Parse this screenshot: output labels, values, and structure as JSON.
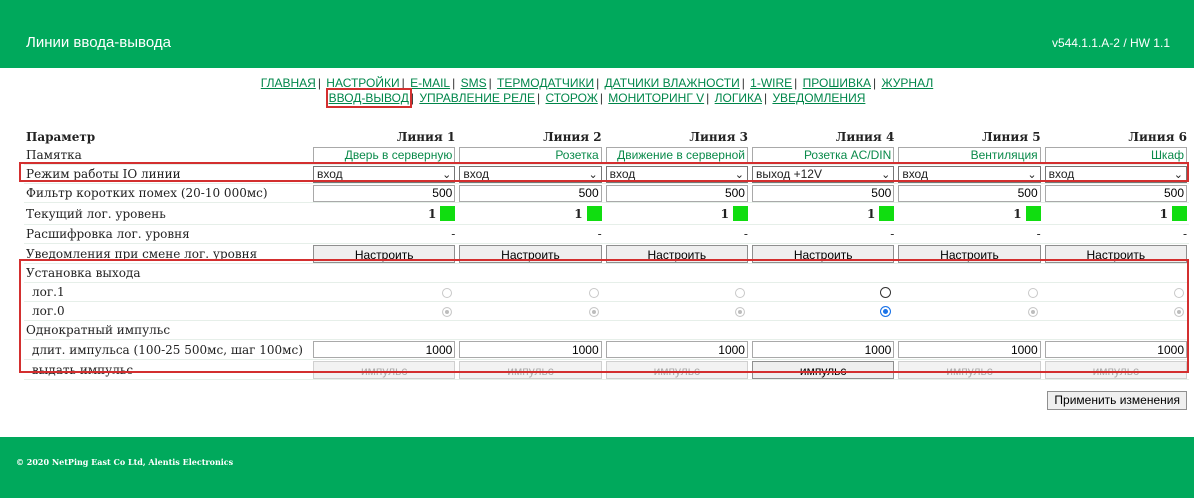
{
  "header": {
    "title": "Линии ввода-вывода",
    "version": "v544.1.1.A-2 / HW 1.1"
  },
  "nav": {
    "row1": [
      "ГЛАВНАЯ",
      "НАСТРОЙКИ",
      "E-MAIL",
      "SMS",
      "ТЕРМОДАТЧИКИ",
      "ДАТЧИКИ ВЛАЖНОСТИ",
      "1-WIRE",
      "ПРОШИВКА",
      "ЖУРНАЛ"
    ],
    "row2": [
      "ВВОД-ВЫВОД",
      "УПРАВЛЕНИЕ РЕЛЕ",
      "СТОРОЖ",
      "МОНИТОРИНГ V",
      "ЛОГИКА",
      "УВЕДОМЛЕНИЯ"
    ]
  },
  "table": {
    "param_header": "Параметр",
    "columns": [
      "Линия 1",
      "Линия 2",
      "Линия 3",
      "Линия 4",
      "Линия 5",
      "Линия 6"
    ],
    "labels": {
      "memo": "Памятка",
      "mode": "Режим работы IO линии",
      "filter": "Фильтр коротких помех (20-10 000мс)",
      "level": "Текущий лог. уровень",
      "decode": "Расшифровка лог. уровня",
      "notify": "Уведомления при смене лог. уровня",
      "output": "Установка выхода",
      "log1": "лог.1",
      "log0": "лог.0",
      "pulse": "Однократный импульс",
      "pulse_len": "длит. импульса (100-25 500мс, шаг 100мс)",
      "pulse_fire": "выдать импульс"
    },
    "memo": [
      "Дверь в серверную",
      "Розетка",
      "Движение в серверной",
      "Розетка AC/DIN",
      "Вентиляция",
      "Шкаф"
    ],
    "mode": [
      "вход",
      "вход",
      "вход",
      "выход +12V",
      "вход",
      "вход"
    ],
    "filter": [
      "500",
      "500",
      "500",
      "500",
      "500",
      "500"
    ],
    "level": [
      "1",
      "1",
      "1",
      "1",
      "1",
      "1"
    ],
    "decode": [
      "-",
      "-",
      "-",
      "-",
      "-",
      "-"
    ],
    "notify_label": "Настроить",
    "output_selected": [
      "log0",
      "log0",
      "log0",
      "log0",
      "log0",
      "log0"
    ],
    "output_enabled": [
      false,
      false,
      false,
      true,
      false,
      false
    ],
    "pulse_len": [
      "1000",
      "1000",
      "1000",
      "1000",
      "1000",
      "1000"
    ],
    "pulse_label": "импульс",
    "pulse_enabled": [
      false,
      false,
      false,
      true,
      false,
      false
    ]
  },
  "apply_label": "Применить изменения",
  "footer": {
    "copyright": "© 2020 NetPing East Co Ltd, Alentis Electronics"
  },
  "colors": {
    "brand": "#00a95c",
    "highlight": "#d32f2f",
    "level_on": "#10dd10"
  }
}
